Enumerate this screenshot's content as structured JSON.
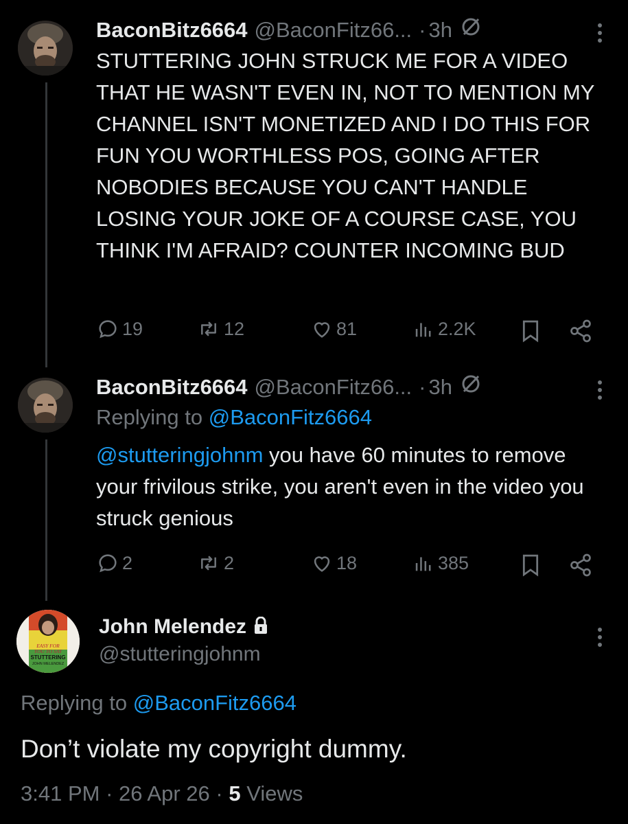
{
  "tweets": [
    {
      "name": "BaconBitz6664",
      "handle": "@BaconFitz66...",
      "sep": "·",
      "time": "3h",
      "text": "STUTTERING JOHN STRUCK ME FOR A VIDEO THAT HE WASN'T EVEN IN, NOT TO MENTION MY CHANNEL ISN'T MONETIZED AND I DO THIS FOR FUN YOU WORTHLESS POS, GOING AFTER NOBODIES BECAUSE YOU CAN'T HANDLE LOSING YOUR JOKE OF A COURSE CASE, YOU THINK I'M AFRAID? COUNTER INCOMING BUD",
      "replies": "19",
      "reposts": "12",
      "likes": "81",
      "views": "2.2K"
    },
    {
      "name": "BaconBitz6664",
      "handle": "@BaconFitz66...",
      "sep": "·",
      "time": "3h",
      "replying_prefix": "Replying to",
      "replying_to": "@BaconFitz6664",
      "mention": "@stutteringjohnm",
      "text": " you have 60 minutes to remove your frivilous strike, you aren't even in the video you struck genious",
      "replies": "2",
      "reposts": "2",
      "likes": "18",
      "views": "385"
    }
  ],
  "main_tweet": {
    "name": "John Melendez",
    "handle": "@stutteringjohnm",
    "replying_prefix": "Replying to",
    "replying_to": "@BaconFitz6664",
    "text": "Don’t violate my copyright dummy.",
    "time": "3:41 PM",
    "date": "26 Apr 26",
    "sep": "·",
    "views_count": "5",
    "views_label": "Views",
    "avatar_text": {
      "line1": "EASY FOR",
      "line2": "YOU TO SAY",
      "line3": "STUTTERING",
      "line4": "JOHN MELENDEZ"
    }
  },
  "colors": {
    "background": "#000000",
    "text": "#e7e9ea",
    "secondary": "#71767b",
    "link": "#1d9bf0"
  },
  "icons": [
    "no-sign-icon",
    "more-icon",
    "reply-icon",
    "repost-icon",
    "like-icon",
    "views-icon",
    "bookmark-icon",
    "share-icon",
    "lock-icon"
  ]
}
